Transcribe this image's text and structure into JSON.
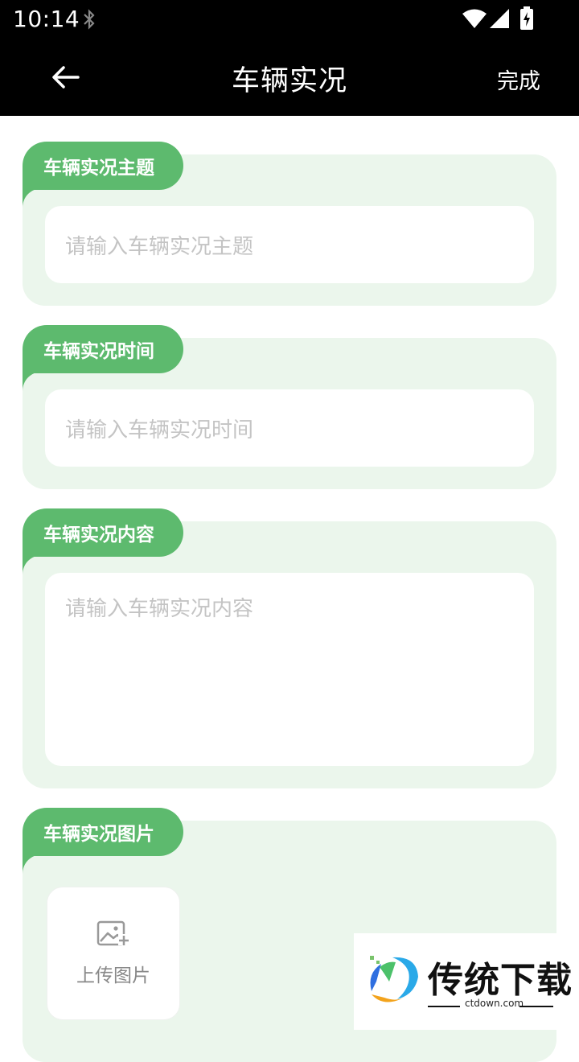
{
  "status": {
    "time": "10:14"
  },
  "appbar": {
    "title": "车辆实况",
    "done_label": "完成"
  },
  "sections": [
    {
      "label": "车辆实况主题",
      "placeholder": "请输入车辆实况主题"
    },
    {
      "label": "车辆实况时间",
      "placeholder": "请输入车辆实况时间"
    },
    {
      "label": "车辆实况内容",
      "placeholder": "请输入车辆实况内容"
    },
    {
      "label": "车辆实况图片",
      "upload_label": "上传图片"
    }
  ],
  "watermark": {
    "brand": "传统下载",
    "site": "ctdown.com"
  },
  "colors": {
    "accent": "#5dba6e",
    "card_bg": "#ebf6ec",
    "bar_bg": "#000000"
  }
}
